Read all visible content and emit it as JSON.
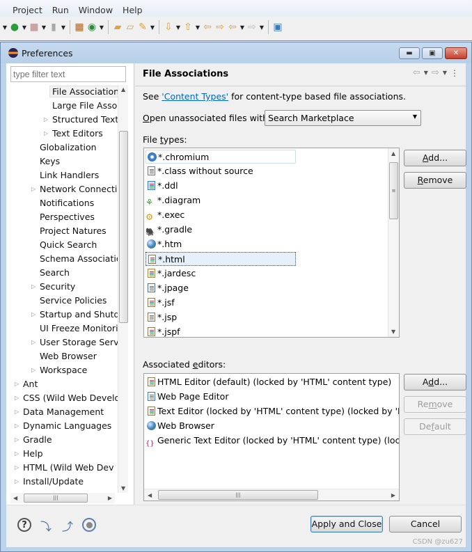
{
  "ide": {
    "menu": [
      "Project",
      "Run",
      "Window",
      "Help"
    ],
    "toolbar_icons": [
      "run-icon",
      "stop-icon",
      "disconnect-icon",
      "new-plugin-icon",
      "new-class-icon",
      "open-type-icon",
      "open-resource-icon",
      "search-icon",
      "next-annotation-icon",
      "previous-annotation-icon",
      "last-edit-icon",
      "forward-edit-icon",
      "back-icon",
      "forward-icon",
      "pin-editor-icon"
    ]
  },
  "dialog": {
    "title": "Preferences",
    "window_controls": {
      "minimize": "minimize",
      "maximize": "maximize",
      "close": "close"
    }
  },
  "left": {
    "filter_placeholder": "type filter text",
    "tree": [
      {
        "label": "File Association",
        "level": 3,
        "expandable": false,
        "selected": true
      },
      {
        "label": "Large File Asso",
        "level": 3,
        "expandable": false
      },
      {
        "label": "Structured Text",
        "level": 3,
        "expandable": true
      },
      {
        "label": "Text Editors",
        "level": 3,
        "expandable": true
      },
      {
        "label": "Globalization",
        "level": 2,
        "expandable": false
      },
      {
        "label": "Keys",
        "level": 2,
        "expandable": false
      },
      {
        "label": "Link Handlers",
        "level": 2,
        "expandable": false
      },
      {
        "label": "Network Connectio",
        "level": 2,
        "expandable": true
      },
      {
        "label": "Notifications",
        "level": 2,
        "expandable": false
      },
      {
        "label": "Perspectives",
        "level": 2,
        "expandable": false
      },
      {
        "label": "Project Natures",
        "level": 2,
        "expandable": false
      },
      {
        "label": "Quick Search",
        "level": 2,
        "expandable": false
      },
      {
        "label": "Schema Associatio",
        "level": 2,
        "expandable": false
      },
      {
        "label": "Search",
        "level": 2,
        "expandable": false
      },
      {
        "label": "Security",
        "level": 2,
        "expandable": true
      },
      {
        "label": "Service Policies",
        "level": 2,
        "expandable": false
      },
      {
        "label": "Startup and Shutdo",
        "level": 2,
        "expandable": true
      },
      {
        "label": "UI Freeze Monitori",
        "level": 2,
        "expandable": false
      },
      {
        "label": "User Storage Servi",
        "level": 2,
        "expandable": true
      },
      {
        "label": "Web Browser",
        "level": 2,
        "expandable": false
      },
      {
        "label": "Workspace",
        "level": 2,
        "expandable": true
      },
      {
        "label": "Ant",
        "level": 1,
        "expandable": true
      },
      {
        "label": "CSS (Wild Web Develo",
        "level": 1,
        "expandable": true
      },
      {
        "label": "Data Management",
        "level": 1,
        "expandable": true
      },
      {
        "label": "Dynamic Languages",
        "level": 1,
        "expandable": true
      },
      {
        "label": "Gradle",
        "level": 1,
        "expandable": true
      },
      {
        "label": "Help",
        "level": 1,
        "expandable": true
      },
      {
        "label": "HTML (Wild Web Dev",
        "level": 1,
        "expandable": true
      },
      {
        "label": "Install/Update",
        "level": 1,
        "expandable": true
      }
    ]
  },
  "main": {
    "title": "File Associations",
    "see_prefix": "See ",
    "see_link": "'Content Types'",
    "see_suffix": " for content-type based file associations.",
    "open_label_mnemonic": "O",
    "open_label_rest": "pen unassociated files with:",
    "open_with_value": "Search Marketplace",
    "file_types_label_pre": "File ",
    "file_types_label_mn": "t",
    "file_types_label_post": "ypes:",
    "file_types": [
      {
        "name": "*.chromium",
        "icon": "chromium-icon",
        "state": "hover"
      },
      {
        "name": "*.class without source",
        "icon": "class-file-icon"
      },
      {
        "name": "*.ddl",
        "icon": "ddl-file-icon"
      },
      {
        "name": "*.diagram",
        "icon": "diagram-file-icon"
      },
      {
        "name": "*.exec",
        "icon": "exec-file-icon"
      },
      {
        "name": "*.gradle",
        "icon": "gradle-elephant-icon"
      },
      {
        "name": "*.htm",
        "icon": "globe-icon"
      },
      {
        "name": "*.html",
        "icon": "text-file-icon",
        "state": "selected"
      },
      {
        "name": "*.jardesc",
        "icon": "jar-file-icon"
      },
      {
        "name": "*.jpage",
        "icon": "java-page-icon"
      },
      {
        "name": "*.jsf",
        "icon": "text-file-icon"
      },
      {
        "name": "*.jsp",
        "icon": "text-file-icon"
      },
      {
        "name": "*.jspf",
        "icon": "text-file-icon"
      }
    ],
    "file_buttons": {
      "add_mn": "A",
      "add_rest": "dd...",
      "remove_mn": "R",
      "remove_rest": "emove"
    },
    "editors_label_pre": "Associated ",
    "editors_label_mn": "e",
    "editors_label_post": "ditors:",
    "editors": [
      {
        "name": "HTML Editor (default) (locked by 'HTML' content type)",
        "icon": "html-editor-icon"
      },
      {
        "name": "Web Page Editor",
        "icon": "web-page-editor-icon"
      },
      {
        "name": "Text Editor (locked by 'HTML' content type) (locked by 'HTML' content type)",
        "icon": "text-editor-icon"
      },
      {
        "name": "Web Browser",
        "icon": "globe-icon"
      },
      {
        "name": "Generic Text Editor (locked by 'HTML' content type) (locked by 'HTML' content type)",
        "icon": "generic-editor-icon"
      }
    ],
    "editor_buttons": {
      "add_pre": "A",
      "add_mn": "d",
      "add_post": "d...",
      "remove_pre": "Re",
      "remove_mn": "m",
      "remove_post": "ove",
      "default_pre": "De",
      "default_mn": "f",
      "default_post": "ault"
    }
  },
  "footer": {
    "apply_close": "Apply and Close",
    "cancel": "Cancel",
    "watermark": "CSDN @zu627"
  }
}
